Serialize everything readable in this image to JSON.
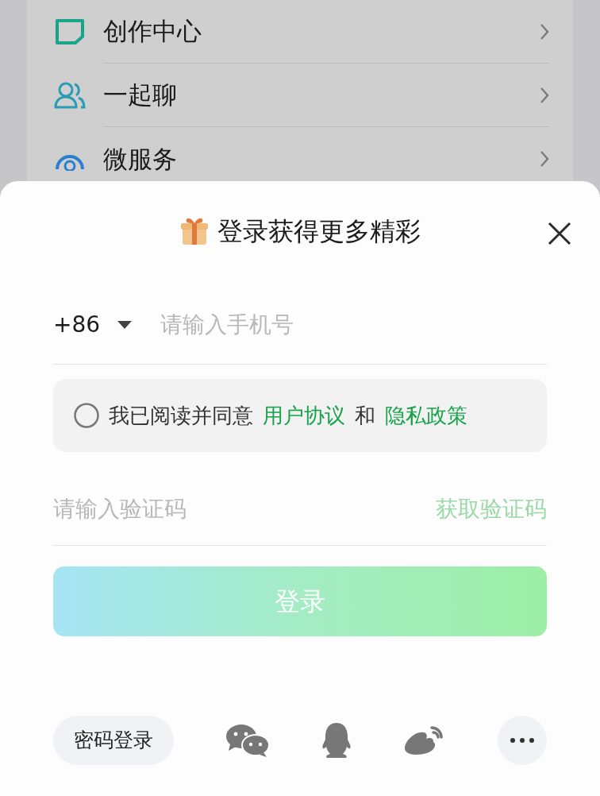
{
  "background_menu": {
    "items": [
      {
        "label": "创作中心",
        "kind": "edit"
      },
      {
        "label": "一起聊",
        "kind": "people"
      },
      {
        "label": "微服务",
        "kind": "service"
      }
    ]
  },
  "login_sheet": {
    "title": "登录获得更多精彩",
    "country_code": "+86",
    "phone": {
      "placeholder": "请输入手机号"
    },
    "agreement": {
      "checked": false,
      "text": "我已阅读并同意",
      "link_1": "用户协议",
      "joiner": "和",
      "link_2": "隐私政策"
    },
    "code": {
      "placeholder": "请输入验证码"
    },
    "get_code": "获取验证码",
    "login_button": "登录",
    "alt_login": {
      "password_button": "密码登录",
      "methods": [
        {
          "kind": "wechat"
        },
        {
          "kind": "qq"
        },
        {
          "kind": "weibo"
        },
        {
          "kind": "more"
        }
      ]
    }
  }
}
